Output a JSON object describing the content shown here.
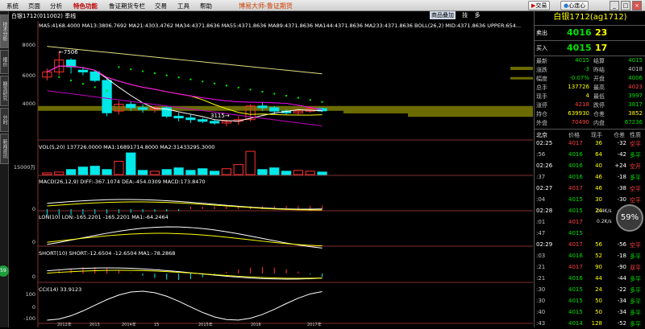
{
  "menu": {
    "items": [
      "系统",
      "页面",
      "分析",
      "特色功能",
      "鲁证期货专栏",
      "交易",
      "工具",
      "帮助"
    ],
    "active_index": 3,
    "brand": "博易大师-鲁证期货",
    "trade_btn": "交易",
    "heart_btn": "心连心"
  },
  "sidetabs": [
    "技术分析",
    "报价",
    "期货研究",
    "分时",
    "新闻资讯"
  ],
  "side_circle": "59",
  "chart": {
    "symbol": "白银1712(011002) 季线",
    "tabs": [
      "商品叠加",
      "技",
      "多"
    ],
    "ma_line": "MA5:4168.4000  MA13:3806.7692  MA21:4303.4762  MA34:4371.8636  MA55:4371.8636  MA89:4371.8636  MA144:4371.8636  MA233:4371.8636  BOLL(26,2) MID:4371.8636  UPPER:654...",
    "vol_line": "VOL(5,20) 137726.0000  MA1:16891714.8000  MA2:31433295.3000",
    "macd_line": "MACD(26,12,9) DIFF:-367.1074  DEA:-454.0309  MACD:173.8470",
    "lon_line": "LON(10) LON:-165.2201  -165.2201  MA1:-64.2464",
    "short_line": "SHORT(10) SHORT:-12.6504  -12.6504  MA1:-78.2868",
    "cci_line": "CCI(14) 33.9123",
    "y_price": [
      "8000",
      "6000",
      "4000"
    ],
    "y_vol": "15000万",
    "y_zero": "0",
    "y_cci": [
      "100",
      "0",
      "-100"
    ],
    "hi_label": "←7506",
    "lo_label": "3115→",
    "x_labels": [
      "2012年",
      "2013",
      "2014年",
      "15",
      "2015年",
      "2016",
      "2017年"
    ]
  },
  "chart_data": {
    "type": "candlestick",
    "title": "白银1712 季线",
    "x": [
      "2012Q1",
      "2012Q2",
      "2012Q3",
      "2012Q4",
      "2013Q1",
      "2013Q2",
      "2013Q3",
      "2013Q4",
      "2014Q1",
      "2014Q2",
      "2014Q3",
      "2014Q4",
      "2015Q1",
      "2015Q2",
      "2015Q3",
      "2015Q4",
      "2016Q1",
      "2016Q2",
      "2016Q3",
      "2016Q4",
      "2017Q1",
      "2017Q2",
      "2017Q3",
      "2017Q4"
    ],
    "open": [
      6000,
      6300,
      7000,
      6400,
      6300,
      5800,
      4000,
      4400,
      4200,
      4100,
      4200,
      3700,
      3600,
      3500,
      3400,
      3300,
      3400,
      3500,
      4300,
      4200,
      4000,
      3900,
      4000,
      4150
    ],
    "close": [
      6300,
      7000,
      6600,
      6300,
      5800,
      3900,
      4400,
      4200,
      4100,
      4200,
      3700,
      3600,
      3500,
      3400,
      3300,
      3400,
      3500,
      4300,
      4200,
      4000,
      3900,
      4000,
      4150,
      4016
    ],
    "high": [
      6500,
      7506,
      7100,
      6600,
      6400,
      5900,
      4600,
      4600,
      4400,
      4300,
      4300,
      3900,
      3800,
      3600,
      3500,
      3500,
      3700,
      4400,
      4500,
      4300,
      4100,
      4200,
      4300,
      4200
    ],
    "low": [
      5800,
      6100,
      6200,
      6100,
      5700,
      3700,
      3800,
      4000,
      3900,
      3900,
      3600,
      3400,
      3300,
      3300,
      3200,
      3115,
      3200,
      3400,
      4000,
      3800,
      3800,
      3800,
      3900,
      3950
    ],
    "volume_wan": [
      1000,
      1500,
      3000,
      4500,
      5000,
      3000,
      8000,
      13000,
      2500,
      2000,
      3000,
      4000,
      2500,
      3500,
      2000,
      3500,
      6000,
      14000,
      3000,
      4000,
      2000,
      2500,
      2000,
      1500
    ],
    "ylim": [
      2400,
      9200
    ],
    "annotations": {
      "high": "7506",
      "low": "3115"
    }
  },
  "quote": {
    "title": "白银1712(ag1712)",
    "sell_label": "卖出",
    "sell_price": "4016",
    "sell_qty": "23",
    "buy_label": "买入",
    "buy_price": "4015",
    "buy_qty": "17",
    "rows": [
      {
        "l1": "最新",
        "v1": "4015",
        "c1": "green",
        "l2": "结算",
        "v2": "4015",
        "c2": "green"
      },
      {
        "l1": "涨跌",
        "v1": "-3",
        "c1": "green",
        "l2": "昨结",
        "v2": "4018",
        "c2": "gray"
      },
      {
        "l1": "幅度",
        "v1": "-0.07%",
        "c1": "green",
        "l2": "开盘",
        "v2": "4006",
        "c2": "green"
      },
      {
        "l1": "总手",
        "v1": "137726",
        "c1": "yellow",
        "l2": "最高",
        "v2": "4023",
        "c2": "red"
      },
      {
        "l1": "现手",
        "v1": "4",
        "c1": "yellow",
        "l2": "最低",
        "v2": "3997",
        "c2": "green"
      },
      {
        "l1": "涨停",
        "v1": "4218",
        "c1": "red",
        "l2": "跌停",
        "v2": "3817",
        "c2": "green"
      },
      {
        "l1": "持仓",
        "v1": "639930",
        "c1": "yellow",
        "l2": "仓差",
        "v2": "3852",
        "c2": "yellow"
      },
      {
        "l1": "外盘",
        "v1": "70490",
        "c1": "red",
        "l2": "内盘",
        "v2": "67236",
        "c2": "green"
      }
    ],
    "ticks_header": {
      "city": "北京",
      "price": "价格",
      "qty": "现手",
      "diff": "仓差",
      "nature": "性质"
    },
    "ticks": [
      {
        "t": "02:25",
        "p": "4017",
        "pc": "red",
        "q": "36",
        "d": "-32",
        "n": "空平",
        "nc": "red"
      },
      {
        "t": ":56",
        "p": "4016",
        "pc": "green",
        "q": "64",
        "d": "-42",
        "n": "多平",
        "nc": "green"
      },
      {
        "t": "02:26",
        "p": "4016",
        "pc": "green",
        "q": "40",
        "d": "+24",
        "n": "空开",
        "nc": "red"
      },
      {
        "t": ":37",
        "p": "4016",
        "pc": "green",
        "q": "46",
        "d": "-18",
        "n": "多平",
        "nc": "green"
      },
      {
        "t": "02:27",
        "p": "4017",
        "pc": "red",
        "q": "46",
        "d": "-38",
        "n": "空平",
        "nc": "red"
      },
      {
        "t": ":04",
        "p": "4015",
        "pc": "green",
        "q": "30",
        "d": "-30",
        "n": "空平",
        "nc": "red"
      },
      {
        "t": "02:28",
        "p": "4015",
        "pc": "green",
        "q": "24",
        "d": "-20",
        "n": "多平",
        "nc": "green"
      },
      {
        "t": ":01",
        "p": "4017",
        "pc": "red",
        "q": "",
        "d": "",
        "n": "",
        "nc": "red"
      },
      {
        "t": ":47",
        "p": "4015",
        "pc": "green",
        "q": "",
        "d": "",
        "n": "",
        "nc": "green"
      },
      {
        "t": "02:29",
        "p": "4017",
        "pc": "red",
        "q": "56",
        "d": "-56",
        "n": "空平",
        "nc": "red"
      },
      {
        "t": ":03",
        "p": "4016",
        "pc": "green",
        "q": "52",
        "d": "-18",
        "n": "多平",
        "nc": "green"
      },
      {
        "t": ":21",
        "p": "4017",
        "pc": "red",
        "q": "90",
        "d": "-90",
        "n": "双平",
        "nc": "red"
      },
      {
        "t": ":21",
        "p": "4016",
        "pc": "green",
        "q": "44",
        "d": "-44",
        "n": "多平",
        "nc": "green"
      },
      {
        "t": ":30",
        "p": "4015",
        "pc": "green",
        "q": "24",
        "d": "-22",
        "n": "多平",
        "nc": "green"
      },
      {
        "t": ":30",
        "p": "4015",
        "pc": "green",
        "q": "50",
        "d": "-34",
        "n": "多平",
        "nc": "green"
      },
      {
        "t": ":40",
        "p": "4015",
        "pc": "green",
        "q": "50",
        "d": "-34",
        "n": "多平",
        "nc": "green"
      },
      {
        "t": ":43",
        "p": "4014",
        "pc": "green",
        "q": "128",
        "d": "-52",
        "n": "多平",
        "nc": "green"
      }
    ],
    "speed_up": "0.4K/s",
    "speed_down": "0.2K/s",
    "gauge": "59%"
  }
}
